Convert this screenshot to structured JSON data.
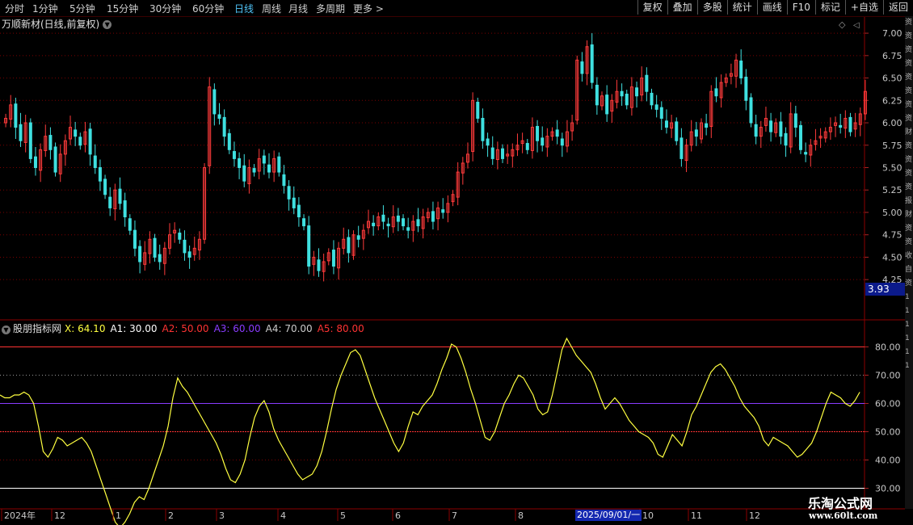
{
  "toolbar": {
    "periods": [
      "分时",
      "1分钟",
      "5分钟",
      "15分钟",
      "30分钟",
      "60分钟",
      "日线",
      "周线",
      "月线",
      "多周期",
      "更多 >"
    ],
    "active_period": "日线",
    "right_buttons": [
      "复权",
      "叠加",
      "多股",
      "统计",
      "画线",
      "F10",
      "标记",
      "+自选",
      "返回"
    ]
  },
  "stock": {
    "title": "万顺新材(日线,前复权)",
    "current_price_tag": "3.93"
  },
  "indicator": {
    "name": "股朋指标网",
    "x_label": "X: 64.10",
    "a1_label": "A1: 30.00",
    "a2_label": "A2: 50.00",
    "a3_label": "A3: 60.00",
    "a4_label": "A4: 70.00",
    "a5_label": "A5: 80.00"
  },
  "time_axis": {
    "labels": [
      "2024年",
      "12",
      "1",
      "2",
      "3",
      "4",
      "5",
      "6",
      "7",
      "8",
      "10",
      "11",
      "12"
    ],
    "highlight_date": "2025/09/01/一"
  },
  "watermark": {
    "line1": "乐淘公式网",
    "line2": "www.60lt.com"
  },
  "right_strip_chars": [
    "资",
    "资",
    "资",
    "资",
    "资",
    "资",
    "资",
    "资",
    "财",
    "资",
    "资",
    "资",
    "资",
    "报",
    "财",
    "资",
    "资",
    "收",
    "自",
    "资",
    "1",
    "1",
    "1",
    "1",
    "1",
    "1"
  ],
  "colors": {
    "up": "#ff3b3b",
    "down": "#3fe0e0",
    "indicator": "#ffff40",
    "a1": "#ffffff",
    "a2": "#ff3333",
    "a3": "#8a3cff",
    "a4": "#bbbbbb",
    "a5": "#ff3333"
  },
  "chart_data": [
    {
      "type": "candlestick",
      "title": "万顺新材(日线,前复权)",
      "ylim": [
        3.9,
        7.1
      ],
      "yticks": [
        "7.00",
        "6.75",
        "6.50",
        "6.25",
        "6.00",
        "5.75",
        "5.50",
        "5.25",
        "5.00",
        "4.75",
        "4.50",
        "4.25"
      ],
      "closes": [
        6.05,
        6.2,
        5.95,
        5.8,
        6.0,
        5.6,
        5.5,
        5.7,
        5.85,
        5.7,
        5.45,
        5.65,
        5.8,
        5.95,
        5.85,
        5.75,
        5.9,
        5.65,
        5.5,
        5.35,
        5.2,
        5.05,
        5.25,
        5.1,
        4.95,
        4.8,
        4.6,
        4.45,
        4.55,
        4.7,
        4.5,
        4.45,
        4.6,
        4.75,
        4.8,
        4.7,
        4.55,
        4.5,
        4.6,
        4.7,
        5.5,
        6.4,
        6.1,
        6.05,
        5.85,
        5.7,
        5.6,
        5.5,
        5.35,
        5.5,
        5.45,
        5.6,
        5.55,
        5.45,
        5.6,
        5.45,
        5.3,
        5.15,
        5.05,
        4.95,
        4.85,
        4.4,
        4.5,
        4.35,
        4.45,
        4.55,
        4.4,
        4.6,
        4.7,
        4.55,
        4.75,
        4.7,
        4.8,
        4.9,
        4.85,
        4.95,
        4.9,
        4.85,
        4.95,
        4.9,
        4.85,
        4.8,
        4.9,
        4.85,
        4.95,
        5.0,
        4.9,
        5.05,
        5.0,
        5.1,
        5.2,
        5.45,
        5.55,
        5.65,
        6.25,
        6.05,
        5.8,
        5.75,
        5.6,
        5.7,
        5.6,
        5.65,
        5.7,
        5.75,
        5.8,
        5.7,
        5.95,
        5.8,
        5.75,
        5.85,
        5.9,
        5.85,
        5.75,
        5.9,
        6.0,
        6.7,
        6.55,
        6.85,
        6.45,
        6.2,
        6.3,
        6.1,
        6.25,
        6.35,
        6.3,
        6.2,
        6.4,
        6.3,
        6.5,
        6.35,
        6.2,
        6.15,
        6.05,
        5.95,
        6.0,
        5.8,
        5.6,
        5.75,
        5.9,
        5.85,
        6.0,
        5.95,
        6.35,
        6.3,
        6.45,
        6.5,
        6.55,
        6.7,
        6.5,
        6.25,
        6.0,
        5.85,
        5.95,
        6.05,
        5.9,
        6.0,
        5.85,
        5.75,
        6.1,
        5.95,
        5.7,
        5.65,
        5.75,
        5.8,
        5.85,
        5.9,
        5.95,
        6.0,
        5.95,
        6.05,
        5.9,
        6.0,
        6.1,
        6.35
      ]
    },
    {
      "type": "line",
      "title": "股朋指标网",
      "ylim": [
        25,
        85
      ],
      "yticks": [
        "80.00",
        "70.00",
        "60.00",
        "50.00",
        "40.00",
        "30.00"
      ],
      "series": [
        {
          "name": "X",
          "values": [
            63,
            62,
            62,
            63,
            63,
            64,
            63,
            60,
            52,
            43,
            41,
            44,
            48,
            47,
            45,
            46,
            47,
            48,
            46,
            43,
            38,
            33,
            28,
            23,
            18,
            16,
            18,
            21,
            25,
            27,
            26,
            30,
            35,
            40,
            45,
            52,
            62,
            69,
            66,
            64,
            61,
            58,
            55,
            52,
            49,
            46,
            42,
            37,
            33,
            32,
            35,
            40,
            48,
            55,
            59,
            61,
            57,
            51,
            47,
            44,
            41,
            38,
            35,
            33,
            34,
            35,
            38,
            43,
            50,
            58,
            65,
            70,
            74,
            78,
            79,
            77,
            72,
            67,
            62,
            58,
            54,
            50,
            46,
            43,
            46,
            52,
            57,
            56,
            59,
            61,
            63,
            67,
            72,
            76,
            81,
            80,
            76,
            71,
            65,
            60,
            54,
            48,
            47,
            50,
            55,
            60,
            63,
            67,
            70,
            69,
            66,
            63,
            58,
            56,
            57,
            63,
            71,
            79,
            83,
            80,
            77,
            75,
            73,
            71,
            67,
            62,
            58,
            60,
            62,
            60,
            57,
            54,
            52,
            50,
            49,
            48,
            46,
            42,
            41,
            45,
            49,
            47,
            45,
            50,
            56,
            59,
            63,
            67,
            71,
            73,
            74,
            72,
            69,
            66,
            62,
            59,
            57,
            55,
            52,
            47,
            45,
            48,
            47,
            46,
            45,
            43,
            41,
            42,
            44,
            46,
            50,
            55,
            60,
            64,
            63,
            62,
            60,
            59,
            61,
            64
          ]
        }
      ],
      "reference_lines": [
        30,
        50,
        60,
        70,
        80
      ]
    }
  ]
}
